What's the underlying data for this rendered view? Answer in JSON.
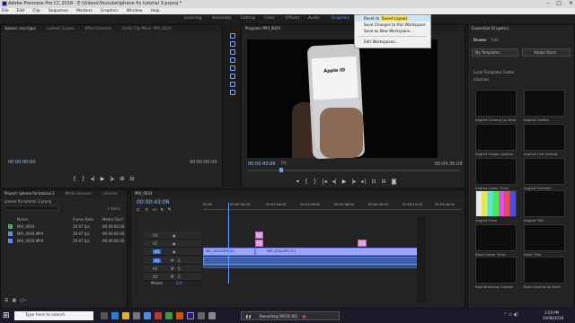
{
  "window": {
    "title": "Adobe Premiere Pro CC 2018 - E:\\Videos\\Youtube\\iphone fix tutorial 3.prproj *"
  },
  "menu": [
    "File",
    "Edit",
    "Clip",
    "Sequence",
    "Markers",
    "Graphics",
    "Window",
    "Help"
  ],
  "workspaces": [
    {
      "label": "Learning",
      "active": false
    },
    {
      "label": "Assembly",
      "active": false
    },
    {
      "label": "Editing",
      "active": false
    },
    {
      "label": "Color",
      "active": false
    },
    {
      "label": "Effects",
      "active": false
    },
    {
      "label": "Audio",
      "active": false
    },
    {
      "label": "Graphics",
      "active": true
    }
  ],
  "workspace_menu": {
    "items": [
      {
        "label": "Reset to Saved Layout",
        "highlight": "Saved Layout"
      },
      {
        "label": "Save Changes to this Workspace"
      },
      {
        "label": "Save as New Workspace..."
      },
      {
        "label": "Edit Workspaces..."
      }
    ]
  },
  "source_panel": {
    "tabs": [
      "Source: (no clips)",
      "Lumetri Scopes",
      "Effect Controls",
      "Audio Clip Mixer: MVI_0024"
    ],
    "timecode_left": "00:00:00:00",
    "timecode_right": "00:00:00:00"
  },
  "program_panel": {
    "title": "Program: MVI_0024",
    "timecode_current": "00:00:43:06",
    "fit_label": "Fit",
    "timecode_duration": "00:04:36:09",
    "screen_title": "Apple ID"
  },
  "project_panel": {
    "tabs": [
      "Project: iphone fix tutorial 3",
      "Media Browser",
      "Libraries"
    ],
    "file": "iphone fix tutorial 3.prproj",
    "item_count": "3 Items",
    "columns": [
      "Name",
      "Frame Rate",
      "Media Start"
    ],
    "rows": [
      {
        "name": "MVI_0024",
        "rate": "29.97 fps",
        "start": "00:00:00:00",
        "color": "#4caf50"
      },
      {
        "name": "MVI_0024.MP4",
        "rate": "29.97 fps",
        "start": "00:00:00:00",
        "color": "#5c8cf0"
      },
      {
        "name": "MVI_0020.MP4",
        "rate": "29.97 fps",
        "start": "00:00:00:00",
        "color": "#5c8cf0"
      }
    ]
  },
  "timeline": {
    "tab": "MVI_0024",
    "timecode": "00:00:43:06",
    "ruler": [
      "00:00",
      "00:00:32:00",
      "00:01:04:00",
      "00:01:36:00",
      "00:02:08:00",
      "00:02:40:00",
      "00:03:12:00",
      "00:03:44:00"
    ],
    "tracks": [
      "V3",
      "V2",
      "V1",
      "A1",
      "A2",
      "A3"
    ],
    "master_label": "Master",
    "master_value": "0.0",
    "clip_labels": [
      "MVI_0024.MP4 [V]",
      "MVI_0024.MP4 [V]"
    ]
  },
  "essential_graphics": {
    "title": "Essential Graphics",
    "tabs": [
      "Browse",
      "Edit"
    ],
    "dropdown": "My Templates",
    "adobe_stock": "Adobe Stock",
    "local_templates": "Local Templates Folder",
    "libraries": "Libraries",
    "templates": [
      "Angled Coming Up Next",
      "Angled Credits",
      "Angled Image Caption",
      "Angled Live Overlay",
      "Angled Lower Third",
      "Angled Presents",
      "Angled Slate",
      "Angled Title",
      "Basic Lower Third",
      "Basic Title",
      "Bold Breaking Caption",
      "Bold Coming Up Next"
    ]
  },
  "taskbar": {
    "search_placeholder": "Type here to search",
    "recording": "Recording [00:01:01]",
    "time": "3:50 PM",
    "date": "10/06/2018"
  },
  "colors": {
    "accent": "#5fa0ff",
    "timecode": "#9ac0ff",
    "video_clip": "#9aa6ff",
    "audio_clip": "#3b5fa8",
    "pink_clip": "#e7a0e4"
  }
}
